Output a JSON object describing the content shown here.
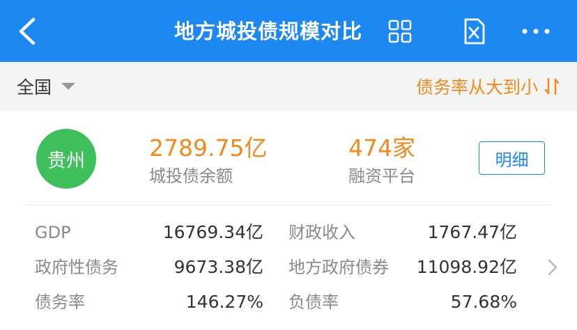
{
  "header": {
    "title": "地方城投债规模对比",
    "background": "#1e88f2"
  },
  "filter": {
    "region": "全国",
    "sort_label": "债务率从大到小"
  },
  "province": {
    "name": "贵州",
    "badge_color": "#3fbf5c",
    "debt_balance_value": "2789.75亿",
    "debt_balance_label": "城投债余额",
    "platforms_value": "474家",
    "platforms_label": "融资平台",
    "detail_label": "明细"
  },
  "metrics": {
    "gdp_label": "GDP",
    "gdp_value": "16769.34亿",
    "revenue_label": "财政收入",
    "revenue_value": "1767.47亿",
    "gov_debt_label": "政府性债务",
    "gov_debt_value": "9673.38亿",
    "local_bond_label": "地方政府债券",
    "local_bond_value": "11098.92亿",
    "debt_ratio_label": "债务率",
    "debt_ratio_value": "146.27%",
    "liability_label": "负债率",
    "liability_value": "57.68%"
  },
  "colors": {
    "accent_orange": "#f08a1c",
    "accent_blue": "#1e88f2"
  }
}
